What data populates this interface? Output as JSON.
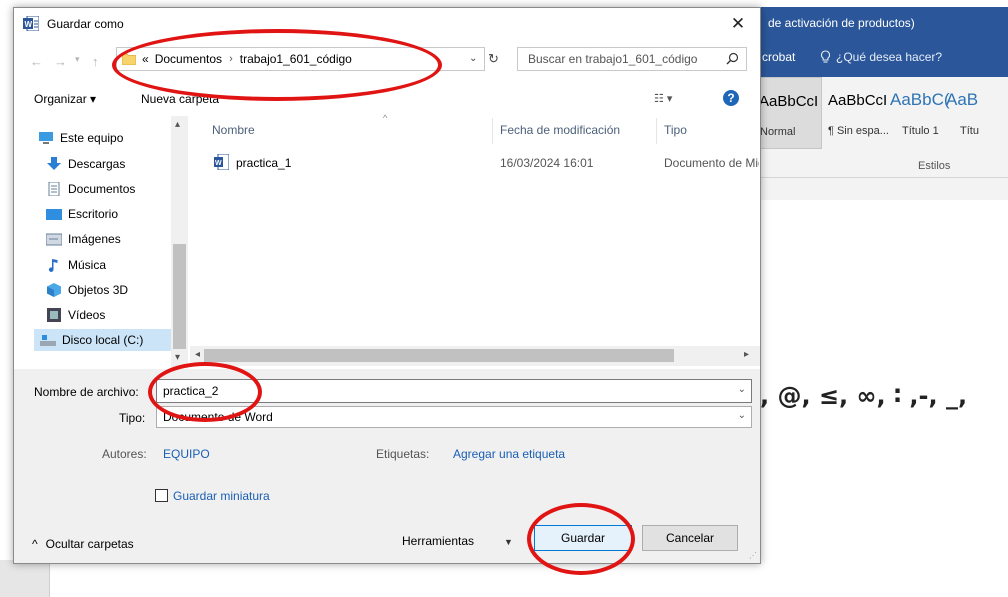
{
  "word": {
    "title_fragment": "de activación de productos)",
    "tab_acrobat": "crobat",
    "tell_me": "¿Qué desea hacer?",
    "styles": [
      {
        "sample": "AaBbCcI",
        "name": "Normal"
      },
      {
        "sample": "AaBbCcI",
        "name": "¶ Sin espa..."
      },
      {
        "sample": "AaBbC(",
        "name": "Título 1"
      },
      {
        "sample": "AaB",
        "name": "Títu"
      }
    ],
    "styles_group": "Estilos",
    "doc_text": ", @, ≤, ∞, ∶ ,-, _,"
  },
  "dialog": {
    "title": "Guardar como",
    "close": "✕",
    "address": {
      "prefix": "«",
      "crumbs": [
        "Documentos",
        "trabajo1_601_código"
      ]
    },
    "search_placeholder": "Buscar en trabajo1_601_código",
    "toolbar": {
      "organize": "Organizar ▾",
      "new_folder": "Nueva carpeta"
    },
    "nav_items": [
      "Este equipo",
      "Descargas",
      "Documentos",
      "Escritorio",
      "Imágenes",
      "Música",
      "Objetos 3D",
      "Vídeos",
      "Disco local (C:)"
    ],
    "columns": [
      "Nombre",
      "Fecha de modificación",
      "Tipo"
    ],
    "files": [
      {
        "name": "practica_1",
        "date": "16/03/2024 16:01",
        "type": "Documento de Microsoft Word"
      }
    ],
    "form": {
      "filename_label": "Nombre de archivo:",
      "filename_value": "practica_2",
      "filetype_label": "Tipo:",
      "filetype_value": "Documento de Word",
      "authors_label": "Autores:",
      "authors_value": "EQUIPO",
      "tags_label": "Etiquetas:",
      "tags_value": "Agregar una etiqueta",
      "thumbnail_label": "Guardar miniatura",
      "hide_folders": "Ocultar carpetas",
      "tools": "Herramientas",
      "save": "Guardar",
      "cancel": "Cancelar"
    }
  },
  "colors": {
    "word_blue": "#2b579a",
    "annotation_red": "#e11414",
    "link_blue": "#1a5fb4",
    "selection": "#cce4f7"
  }
}
